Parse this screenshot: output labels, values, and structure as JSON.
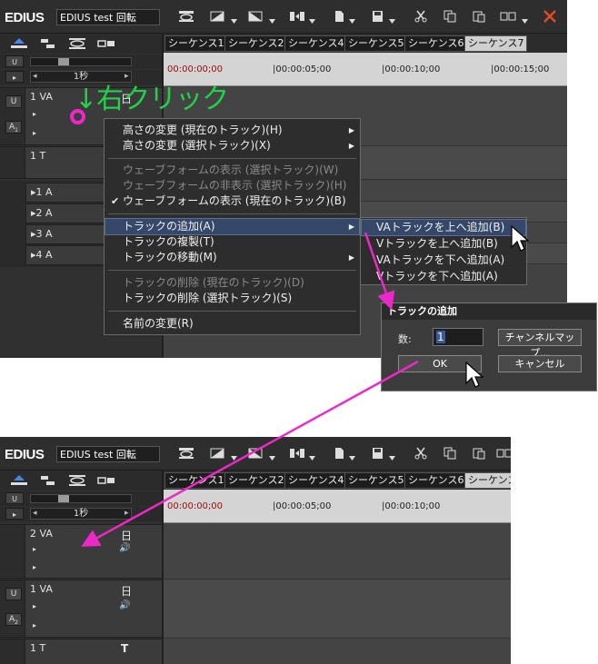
{
  "app": {
    "logo": "EDIUS",
    "project_name": "EDIUS test 回転"
  },
  "sequence_tabs": [
    "シーケンス1",
    "シーケンス2",
    "シーケンス4",
    "シーケンス5",
    "シーケンス6",
    "シーケンス7"
  ],
  "timecodes": [
    "00:00:00;00",
    "|00:00:05;00",
    "|00:00:10;00",
    "|00:00:15;00"
  ],
  "controls": {
    "zoom_label": "1秒",
    "slider_label": "III",
    "lock_glyph": "U",
    "patch_a": "A",
    "patch_v": "U"
  },
  "tracks_before": {
    "va": "1 VA",
    "va_icon": "日",
    "t": "1 T",
    "t_icon": "T",
    "audio": [
      "▸1 A",
      "▸2 A",
      "▸3 A",
      "▸4 A"
    ]
  },
  "tracks_after": {
    "va2": "2 VA",
    "va1": "1 VA",
    "t": "1 T",
    "va_icon": "日",
    "speaker_icon": "🔊",
    "t_icon": "T"
  },
  "annotation": {
    "text": "↓右クリック"
  },
  "context_menu": {
    "items": [
      {
        "label": "高さの変更 (現在のトラック)(H)",
        "disabled": false,
        "submenu": true
      },
      {
        "label": "高さの変更 (選択トラック)(X)",
        "disabled": false,
        "submenu": true
      },
      {
        "label": "ウェーブフォームの表示 (選択トラック)(W)",
        "disabled": true,
        "submenu": false
      },
      {
        "label": "ウェーブフォームの非表示 (選択トラック)(H)",
        "disabled": true,
        "submenu": false
      },
      {
        "label": "ウェーブフォームの表示 (現在のトラック)(B)",
        "disabled": false,
        "checked": true
      },
      {
        "label": "トラックの追加(A)",
        "disabled": false,
        "submenu": true,
        "highlighted": true
      },
      {
        "label": "トラックの複製(T)",
        "disabled": false
      },
      {
        "label": "トラックの移動(M)",
        "disabled": false,
        "submenu": true
      },
      {
        "label": "トラックの削除 (現在のトラック)(D)",
        "disabled": true
      },
      {
        "label": "トラックの削除 (選択トラック)(S)",
        "disabled": false
      },
      {
        "label": "名前の変更(R)",
        "disabled": false
      }
    ]
  },
  "submenu": {
    "items": [
      "VAトラックを上へ追加(B)",
      "Vトラックを上へ追加(B)",
      "VAトラックを下へ追加(A)",
      "Vトラックを下へ追加(A)"
    ]
  },
  "dialog": {
    "title": "トラックの追加",
    "count_label": "数:",
    "count_value": "1",
    "channel_map_button": "チャンネルマップ...",
    "ok_button": "OK",
    "cancel_button": "キャンセル"
  },
  "colors": {
    "annotation_green": "#22d24a",
    "annotation_magenta": "#ee28c8",
    "menu_highlight": "#36486a",
    "panel": "#3a3a3a"
  }
}
